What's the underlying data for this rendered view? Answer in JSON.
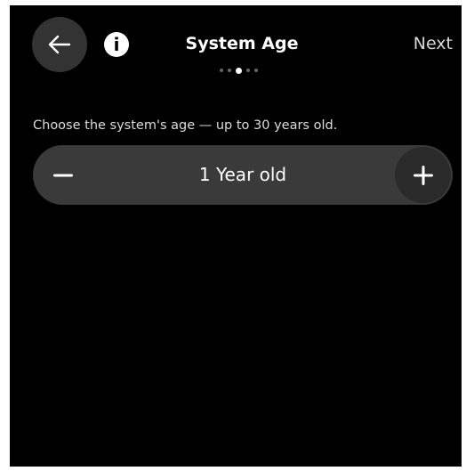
{
  "header": {
    "back_icon": "arrow-left-icon",
    "info_label": "i",
    "title": "System Age",
    "next_label": "Next",
    "pagination": {
      "total": 5,
      "active_index": 2
    }
  },
  "main": {
    "instruction": "Choose the system's age — up to 30 years old.",
    "stepper": {
      "value_label": "1 Year old",
      "decrement_icon": "minus-icon",
      "increment_icon": "plus-icon"
    }
  },
  "colors": {
    "background": "#000000",
    "button_background": "#333333",
    "stepper_background": "#3a3a3a",
    "text": "#ffffff",
    "inactive_dot": "#666666"
  }
}
